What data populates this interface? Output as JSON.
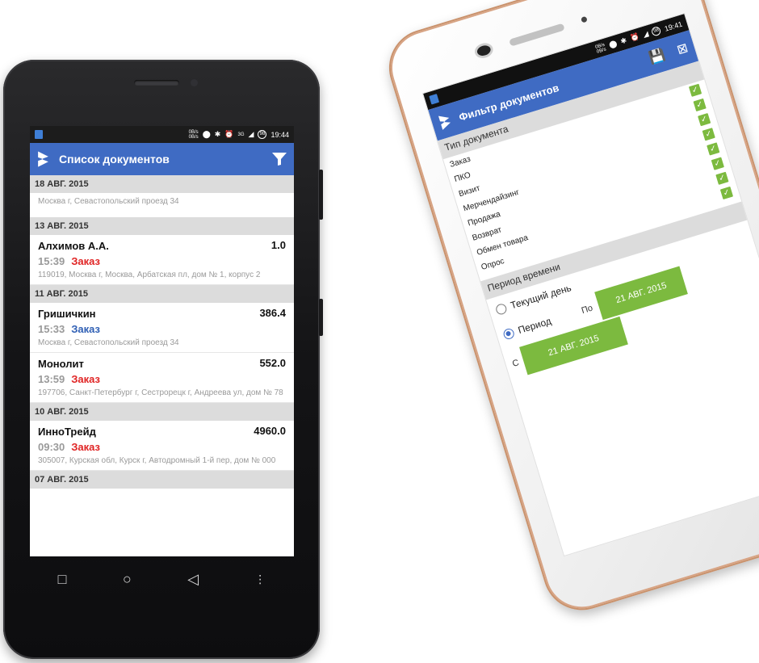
{
  "left_phone": {
    "status": {
      "net_top": "0B/s",
      "net_bottom": "0B/s",
      "signal": "3G",
      "battery": "98",
      "time": "19:44"
    },
    "app_title": "Список документов",
    "sections": [
      {
        "date": "18 АВГ. 2015",
        "items": [
          {
            "address_only": "Москва г, Севастопольский проезд 34"
          }
        ]
      },
      {
        "date": "13 АВГ. 2015",
        "items": [
          {
            "client": "Алхимов А.А.",
            "sum": "1.0",
            "time": "15:39",
            "kind": "Заказ",
            "kind_color": "#e02424",
            "address": "119019, Москва г, Москва, Арбатская пл, дом № 1, корпус 2"
          }
        ]
      },
      {
        "date": "11 АВГ. 2015",
        "items": [
          {
            "client": "Гришичкин",
            "sum": "386.4",
            "time": "15:33",
            "kind": "Заказ",
            "kind_color": "#2f5fb4",
            "address": "Москва г, Севастопольский проезд 34"
          },
          {
            "client": "Монолит",
            "sum": "552.0",
            "time": "13:59",
            "kind": "Заказ",
            "kind_color": "#e02424",
            "address": "197706, Санкт-Петербург г, Сестрорецк г, Андреева ул, дом № 78"
          }
        ]
      },
      {
        "date": "10 АВГ. 2015",
        "items": [
          {
            "client": "ИнноТрейд",
            "sum": "4960.0",
            "time": "09:30",
            "kind": "Заказ",
            "kind_color": "#e02424",
            "address": "305007, Курская обл, Курск г, Автодромный 1-й пер, дом № 000"
          }
        ]
      },
      {
        "date": "07 АВГ. 2015",
        "items": []
      }
    ],
    "nav": {
      "recent": "□",
      "home": "○",
      "back": "◁",
      "menu": "⋮"
    }
  },
  "right_phone": {
    "status": {
      "net_top": "0B/s",
      "net_bottom": "0B/s",
      "battery": "98",
      "time": "19:41"
    },
    "app_title": "Фильтр документов",
    "doc_type_header": "Тип документа",
    "doc_types": [
      {
        "label": "Заказ",
        "checked": true
      },
      {
        "label": "ПКО",
        "checked": true
      },
      {
        "label": "Визит",
        "checked": true
      },
      {
        "label": "Мерчендайзинг",
        "checked": true
      },
      {
        "label": "Продажа",
        "checked": true
      },
      {
        "label": "Возврат",
        "checked": true
      },
      {
        "label": "Обмен товара",
        "checked": true
      },
      {
        "label": "Опрос",
        "checked": true
      }
    ],
    "period_header": "Период времени",
    "radio_current": "Текущий день",
    "radio_period": "Период",
    "from_label": "С",
    "to_label": "По",
    "from_date": "21 АВГ. 2015",
    "to_date": "21 АВГ. 2015"
  },
  "colors": {
    "accent": "#3f6bc3",
    "green": "#7cba3f",
    "red": "#e02424",
    "blue": "#2f5fb4"
  }
}
